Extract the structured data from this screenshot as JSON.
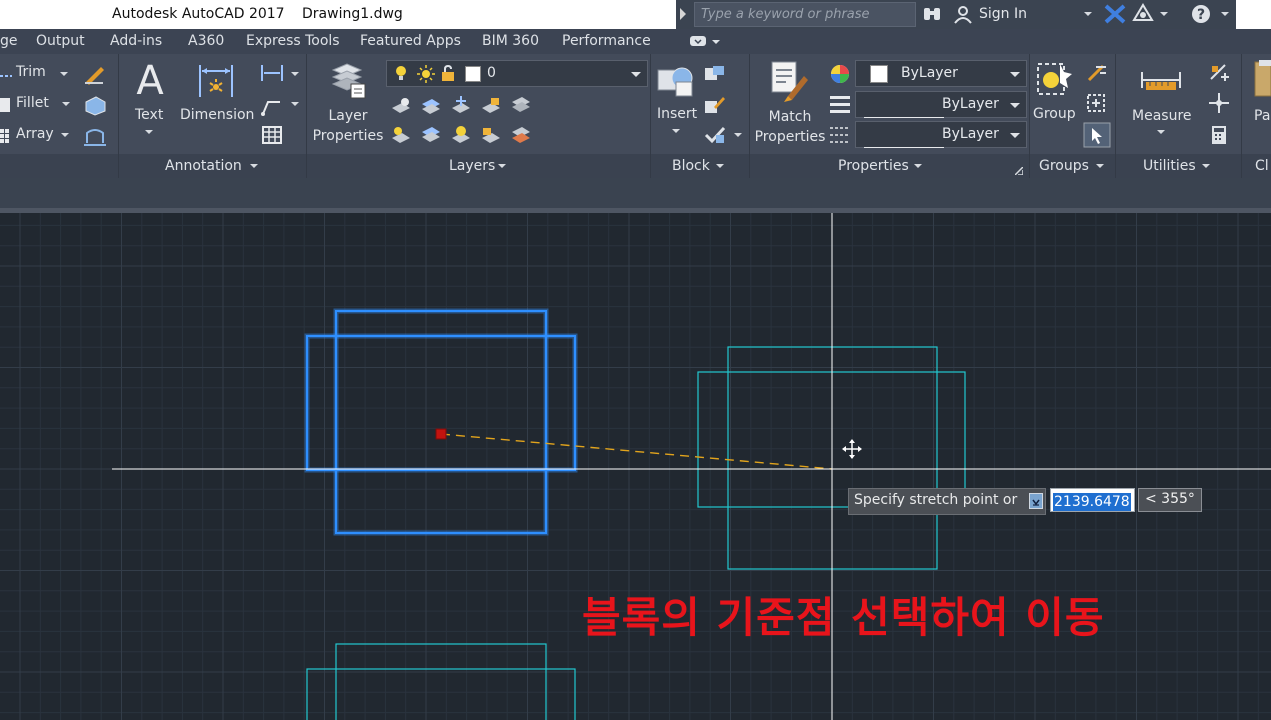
{
  "titlebar": {
    "app_title": "Autodesk AutoCAD 2017",
    "doc_title": "Drawing1.dwg",
    "search_placeholder": "Type a keyword or phrase",
    "signin_label": "Sign In"
  },
  "ribbon_tabs": [
    "ge",
    "Output",
    "Add-ins",
    "A360",
    "Express Tools",
    "Featured Apps",
    "BIM 360",
    "Performance"
  ],
  "modify_panel": {
    "trim_label": "Trim",
    "fillet_label": "Fillet",
    "array_label": "Array"
  },
  "annotation_panel": {
    "text_label": "Text",
    "text_glyph": "A",
    "dimension_label": "Dimension",
    "title": "Annotation"
  },
  "layers_panel": {
    "layer_properties_label": "Layer\nProperties",
    "current_layer": "0",
    "title": "Layers"
  },
  "block_panel": {
    "insert_label": "Insert",
    "title": "Block"
  },
  "properties_panel": {
    "match_label": "Match\nProperties",
    "color_value": "ByLayer",
    "linetype_value": "ByLayer",
    "lineweight_value": "ByLayer",
    "title": "Properties"
  },
  "groups_panel": {
    "group_label": "Group",
    "title": "Groups"
  },
  "utilities_panel": {
    "measure_label": "Measure",
    "title": "Utilities"
  },
  "clipboard_panel": {
    "paste_label": "Pa",
    "title": "Cl"
  },
  "prompt": {
    "text": "Specify stretch point or",
    "distance_value": "2139.6478",
    "angle_value": "< 355°"
  },
  "annotation_text": "블록의 기준점 선택하여 이동",
  "colors": {
    "canvas_bg": "#212830",
    "selected_block": "#2e8fff",
    "preview_block": "#22c7cf",
    "rubberband": "#e2a41c",
    "crosshair": "#ffffff",
    "annotation": "#e8141b"
  }
}
